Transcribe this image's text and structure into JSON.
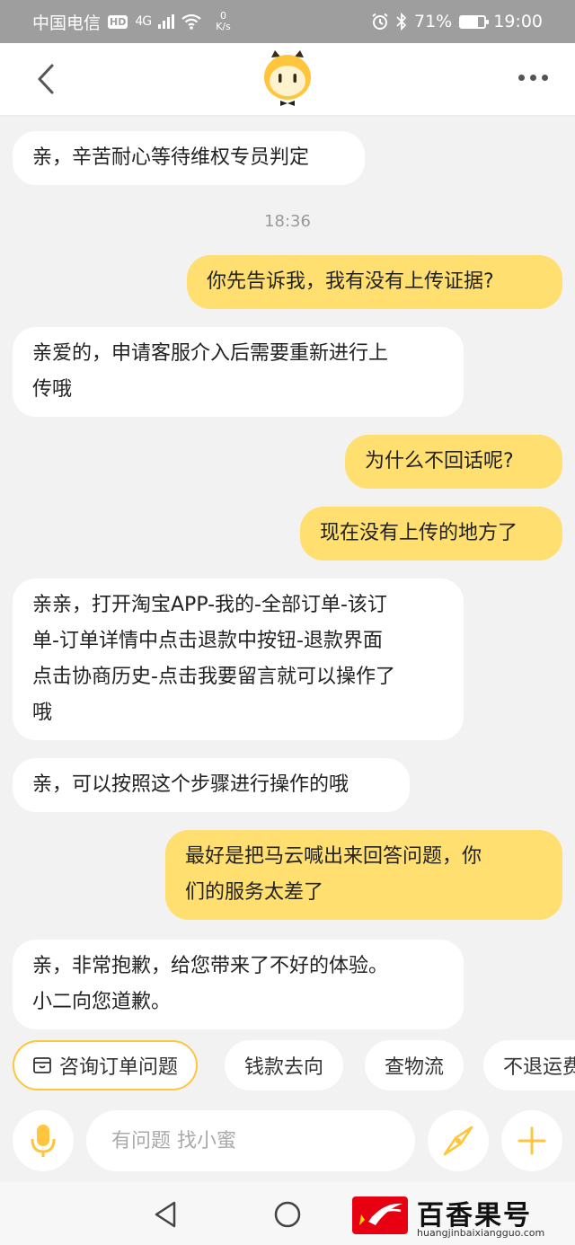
{
  "status_bar": {
    "carrier": "中国电信",
    "hd": "HD",
    "network": "4G",
    "speed_value": "0",
    "speed_unit": "K/s",
    "battery": "71%",
    "battery_level": 0.71,
    "time": "19:00"
  },
  "header": {
    "back_icon": "chevron-left-icon",
    "mascot_icon": "owl-mascot-icon",
    "more_icon": "more-horizontal-icon"
  },
  "messages": [
    {
      "side": "left",
      "text": "亲，辛苦耐心等待维权专员判定"
    },
    {
      "side": "timestamp",
      "text": "18:36"
    },
    {
      "side": "right",
      "text": "你先告诉我，我有没有上传证据?"
    },
    {
      "side": "left",
      "lines": [
        "亲爱的，申请客服介入后需要重新进行上",
        "传哦"
      ]
    },
    {
      "side": "right",
      "text": "为什么不回话呢?"
    },
    {
      "side": "right",
      "text": "现在没有上传的地方了"
    },
    {
      "side": "left",
      "lines": [
        "亲亲，打开淘宝APP-我的-全部订单-该订",
        "单-订单详情中点击退款中按钮-退款界面",
        "点击协商历史-点击我要留言就可以操作了",
        "哦"
      ]
    },
    {
      "side": "left",
      "text": "亲，可以按照这个步骤进行操作的哦"
    },
    {
      "side": "right",
      "lines": [
        "最好是把马云喊出来回答问题，你",
        "们的服务太差了"
      ]
    },
    {
      "side": "left",
      "lines": [
        "亲，非常抱歉，给您带来了不好的体验。",
        "小二向您道歉。"
      ]
    }
  ],
  "quick_replies": [
    "咨询订单问题",
    "钱款去向",
    "查物流",
    "不退运费"
  ],
  "input": {
    "placeholder": "有问题 找小蜜",
    "mic_icon": "microphone-icon",
    "compass_icon": "compass-icon",
    "add_icon": "plus-icon"
  },
  "nav": {
    "back_icon": "triangle-back-icon",
    "home_icon": "circle-home-icon"
  },
  "watermark": {
    "title": "百香果号",
    "url": "huangjinbaixiangguo.com"
  },
  "colors": {
    "accent": "#ffc53d",
    "right_bubble": "#ffdf6f",
    "left_bubble": "#ffffff",
    "background": "#f2f2f2"
  }
}
